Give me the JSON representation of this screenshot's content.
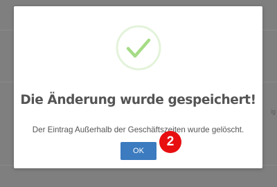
{
  "dialog": {
    "title": "Die Änderung wurde gespeichert!",
    "message": "Der Eintrag Außerhalb der Geschäftszeiten wurde gelöscht.",
    "ok_label": "OK",
    "icon": "checkmark-icon",
    "accent_color": "#3c7bbf",
    "success_color": "#a5dc86"
  },
  "annotation": {
    "step_number": "2",
    "color": "#e80f10"
  },
  "background": {
    "edge_text": "ig"
  }
}
